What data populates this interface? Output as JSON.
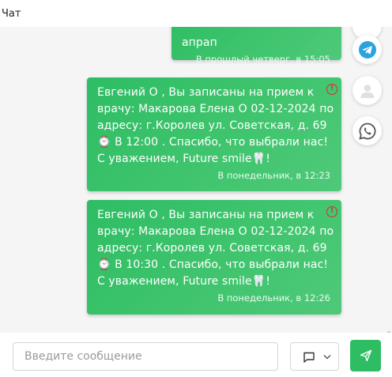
{
  "header": {
    "title": "Чат"
  },
  "messages": [
    {
      "text": "апрап",
      "time": "В прошлый четверг, в 15:05",
      "has_warning": false
    },
    {
      "text": "Евгений  О , Вы записаны на прием к врачу: Макарова Елена О  02-12-2024 по адресу:  г.Королев  ул. Советская, д. 69 ⌚ В  12:00 . Спасибо, что выбрали нас! С уважением, Future smile🦷!",
      "time": "В понедельник, в 12:23",
      "has_warning": true,
      "warning_symbol": "!"
    },
    {
      "text": "Евгений  О , Вы записаны на прием к врачу: Макарова Елена О  02-12-2024 по адресу:  г.Королев  ул. Советская, д. 69 ⌚ В  10:30 . Спасибо, что выбрали нас! С уважением, Future smile🦷!",
      "time": "В понедельник, в 12:26",
      "has_warning": true,
      "warning_symbol": "!"
    }
  ],
  "side_buttons": [
    {
      "icon": "telegram-icon",
      "color": "#2aa3df"
    },
    {
      "icon": "user-icon",
      "color": "#e0e0e0"
    },
    {
      "icon": "whatsapp-icon",
      "color": "#555555"
    }
  ],
  "composer": {
    "placeholder": "Введите сообщение",
    "channel_icon": "message-icon",
    "send_icon": "send-icon"
  },
  "colors": {
    "bubble": "#3cc36b",
    "accent": "#2fbd63",
    "warning": "#d32f2f"
  }
}
